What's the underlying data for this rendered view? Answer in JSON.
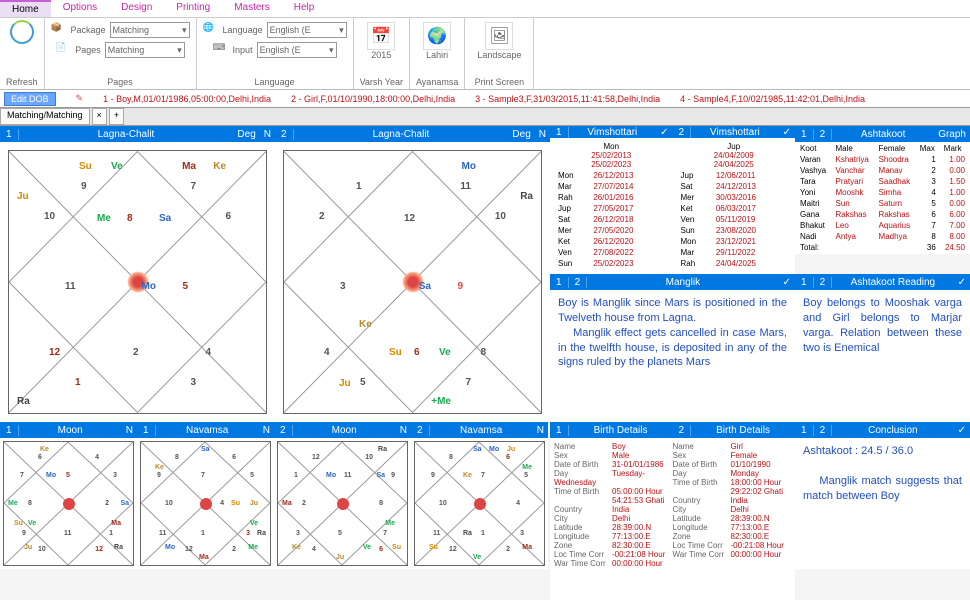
{
  "menu": {
    "items": [
      "Home",
      "Options",
      "Design",
      "Printing",
      "Masters",
      "Help"
    ],
    "active": "Home"
  },
  "ribbon": {
    "refresh": "Refresh",
    "package_lbl": "Package",
    "package_val": "Matching",
    "pages_lbl": "Pages",
    "pages_val": "Matching",
    "pages_grp": "Pages",
    "language_lbl": "Language",
    "language_val": "English (E",
    "input_lbl": "Input",
    "input_val": "English (E",
    "language_grp": "Language",
    "year_val": "2015",
    "year_grp": "Varsh Year",
    "ayan_val": "Lahiri",
    "ayan_grp": "Ayanamsa",
    "ps_val": "Landscape",
    "ps_grp": "Print Screen"
  },
  "records": {
    "editdob": "Edit DOB",
    "r1": "1 - Boy,M,01/01/1986,05:00:00,Delhi,India",
    "r2": "2 - Girl,F,01/10/1990,18:00:00,Delhi,India",
    "r3": "3 - Sample3,F,31/03/2015,11:41:58,Delhi,India",
    "r4": "4 - Sample4,F,10/02/1985,11:42:01,Delhi,India"
  },
  "tab": {
    "name": "Matching/Matching"
  },
  "lagna": {
    "title": "Lagna-Chalit",
    "deg": "Deg",
    "n": "N",
    "num1": "1",
    "num2": "2"
  },
  "chart1": {
    "houses": [
      "1",
      "2",
      "3",
      "4",
      "5",
      "6",
      "7",
      "8",
      "9",
      "10",
      "11",
      "12"
    ],
    "planets": {
      "Su": "Su",
      "Ve": "Ve",
      "Ma": "Ma",
      "Ke": "Ke",
      "Ju": "Ju",
      "Me": "Me",
      "Sa": "Sa",
      "Mo": "Mo",
      "Ra": "Ra"
    },
    "hpos": {
      "Me": "8",
      "Mo": "5"
    }
  },
  "chart2": {
    "planets": {
      "Mo": "Mo",
      "Ra": "Ra",
      "Ke": "Ke",
      "Su": "Su",
      "Ve": "Ve",
      "Ju": "Ju",
      "Me": "+Me",
      "Sa": "Sa"
    },
    "hpos": {
      "Sa": "9",
      "Su": "6"
    }
  },
  "mini": {
    "moon": "Moon",
    "nav": "Navamsa",
    "n": "N",
    "one": "1",
    "two": "2"
  },
  "vimsh": {
    "title": "Vimshottari",
    "left": {
      "head": "Mon",
      "d1": "25/02/2013",
      "d2": "25/02/2023",
      "rows": [
        [
          "Mon",
          "26/12/2013"
        ],
        [
          "Mar",
          "27/07/2014"
        ],
        [
          "Rah",
          "26/01/2016"
        ],
        [
          "Jup",
          "27/05/2017"
        ],
        [
          "Sat",
          "26/12/2018"
        ],
        [
          "Mer",
          "27/05/2020"
        ],
        [
          "Ket",
          "26/12/2020"
        ],
        [
          "Ven",
          "27/08/2022"
        ],
        [
          "Sun",
          "25/02/2023"
        ]
      ]
    },
    "right": {
      "head": "Jup",
      "d1": "24/04/2009",
      "d2": "24/04/2025",
      "rows": [
        [
          "Jup",
          "12/06/2011"
        ],
        [
          "Sat",
          "24/12/2013"
        ],
        [
          "Mer",
          "30/03/2016"
        ],
        [
          "Ket",
          "06/03/2017"
        ],
        [
          "Ven",
          "05/11/2019"
        ],
        [
          "Sun",
          "23/08/2020"
        ],
        [
          "Mon",
          "23/12/2021"
        ],
        [
          "Mar",
          "29/11/2022"
        ],
        [
          "Rah",
          "24/04/2025"
        ]
      ]
    }
  },
  "ashta": {
    "title": "Ashtakoot",
    "graph": "Graph",
    "head": [
      "Koot",
      "Male",
      "Female",
      "Max",
      "Mark"
    ],
    "rows": [
      [
        "Varan",
        "Kshatriya",
        "Shoodra",
        "1",
        "1.00"
      ],
      [
        "Vashya",
        "Vanchar",
        "Manav",
        "2",
        "0.00"
      ],
      [
        "Tara",
        "Pratyari",
        "Saadhak",
        "3",
        "1.50"
      ],
      [
        "Yoni",
        "Mooshk",
        "Simha",
        "4",
        "1.00"
      ],
      [
        "Maitri",
        "Sun",
        "Saturn",
        "5",
        "0.00"
      ],
      [
        "Gana",
        "Rakshas",
        "Rakshas",
        "6",
        "6.00"
      ],
      [
        "Bhakut",
        "Leo",
        "Aquarius",
        "7",
        "7.00"
      ],
      [
        "Nadi",
        "Antya",
        "Madhya",
        "8",
        "8.00"
      ]
    ],
    "total": [
      "Total:",
      "",
      "",
      "36",
      "24.50"
    ]
  },
  "manglik": {
    "title": "Manglik",
    "text": "Boy is Manglik since Mars is positioned in the Twelveth house from Lagna.\n    Manglik effect gets cancelled in case Mars, in the twelfth house, is deposited in any of the signs ruled by the planets Mars"
  },
  "ashta_read": {
    "title": "Ashtakoot Reading",
    "text": "Boy belongs to Mooshak varga and Girl belongs to Marjar varga. Relation between these two is Enemical"
  },
  "bd": {
    "title": "Birth Details",
    "boy": {
      "Name": "Boy",
      "Sex": "Male",
      "Date of Birth": "31-01/01/1986",
      "Day": "Tuesday-Wednesday",
      "Time of Birth": "05:00:00 Hour",
      "": "54:21:53 Ghati",
      "Country": "India",
      "City": "Delhi",
      "Latitude": "28:39:00.N",
      "Longitude": "77:13:00.E",
      "Zone": "82:30:00.E",
      "Loc Time Corr": "-00:21:08 Hour",
      "War Time Corr": "00:00:00 Hour"
    },
    "girl": {
      "Name": "Girl",
      "Sex": "Female",
      "Date of Birth": "01/10/1990",
      "Day": "Monday",
      "Time of Birth": "18:00:00 Hour",
      "": "29:22:02 Ghati",
      "Country": "India",
      "City": "Delhi",
      "Latitude": "28:39:00.N",
      "Longitude": "77:13:00.E",
      "Zone": "82:30:00.E",
      "Loc Time Corr": "-00:21:08 Hour",
      "War Time Corr": "00:00:00 Hour"
    }
  },
  "concl": {
    "title": "Conclusion",
    "text": "Ashtakoot : 24.5 / 36.0\n\n    Manglik match suggests that match between Boy"
  }
}
